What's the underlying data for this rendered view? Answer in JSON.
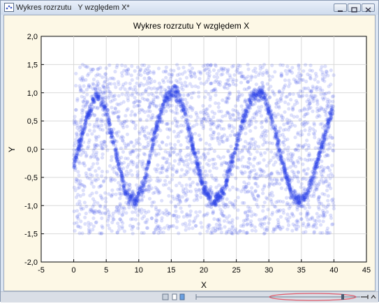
{
  "window": {
    "title": "Wykres rozrzutu   Y względem X*"
  },
  "chart_data": {
    "type": "scatter",
    "title": "Wykres rozrzutu   Y względem X",
    "xlabel": "X",
    "ylabel": "Y",
    "xlim": [
      -5,
      45
    ],
    "ylim": [
      -2.0,
      2.0
    ],
    "x_ticks": [
      "-5",
      "0",
      "5",
      "10",
      "15",
      "20",
      "25",
      "30",
      "35",
      "40",
      "45"
    ],
    "y_ticks": [
      "2,0",
      "1,5",
      "1,0",
      "0,5",
      "0,0",
      "-0,5",
      "-1,0",
      "-1,5",
      "-2,0"
    ],
    "grid": true,
    "point_color": "#2a3ee8",
    "series": [
      {
        "background": {
          "x_range": [
            0,
            40
          ],
          "y_range": [
            -1.5,
            1.5
          ]
        },
        "curve": [
          [
            0.0,
            -0.3
          ],
          [
            2.0,
            0.55
          ],
          [
            3.5,
            1.0
          ],
          [
            5.0,
            0.7
          ],
          [
            6.5,
            -0.1
          ],
          [
            8.0,
            -0.75
          ],
          [
            9.5,
            -0.95
          ],
          [
            11.0,
            -0.55
          ],
          [
            12.5,
            0.3
          ],
          [
            14.0,
            0.85
          ],
          [
            15.5,
            1.05
          ],
          [
            17.0,
            0.7
          ],
          [
            18.5,
            -0.05
          ],
          [
            20.0,
            -0.7
          ],
          [
            21.5,
            -0.95
          ],
          [
            23.0,
            -0.75
          ],
          [
            24.5,
            -0.15
          ],
          [
            26.0,
            0.5
          ],
          [
            27.5,
            0.95
          ],
          [
            29.0,
            1.0
          ],
          [
            30.5,
            0.55
          ],
          [
            32.0,
            -0.2
          ],
          [
            33.5,
            -0.8
          ],
          [
            35.0,
            -0.95
          ],
          [
            36.5,
            -0.6
          ],
          [
            38.0,
            0.0
          ],
          [
            39.5,
            0.6
          ],
          [
            40.0,
            0.75
          ]
        ]
      }
    ]
  },
  "colors": {
    "plot_bg": "#ffffff",
    "outer_bg": "#fdf8e6",
    "grid": "#d9d9d9"
  }
}
